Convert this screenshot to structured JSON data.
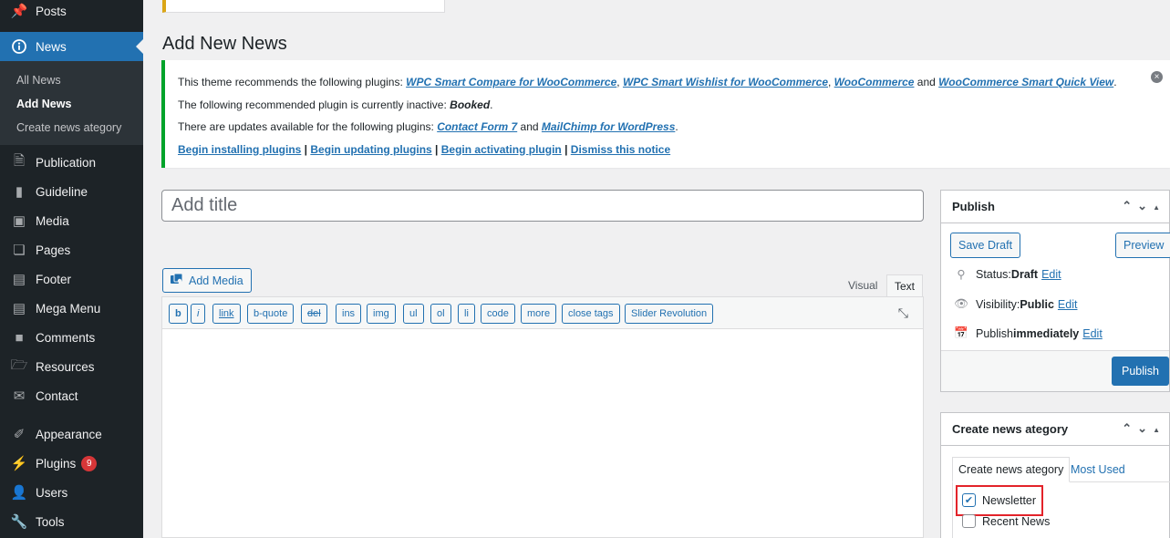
{
  "sidebar": {
    "items": [
      {
        "label": "Posts",
        "icon": "pin-icon"
      },
      {
        "label": "News",
        "icon": "info-icon"
      },
      {
        "label": "Publication",
        "icon": "document-icon"
      },
      {
        "label": "Guideline",
        "icon": "book-icon"
      },
      {
        "label": "Media",
        "icon": "media-icon"
      },
      {
        "label": "Pages",
        "icon": "pages-icon"
      },
      {
        "label": "Footer",
        "icon": "table-icon"
      },
      {
        "label": "Mega Menu",
        "icon": "table-icon"
      },
      {
        "label": "Comments",
        "icon": "comment-icon"
      },
      {
        "label": "Resources",
        "icon": "folder-icon"
      },
      {
        "label": "Contact",
        "icon": "mail-icon"
      },
      {
        "label": "Appearance",
        "icon": "brush-icon"
      },
      {
        "label": "Plugins",
        "icon": "plugin-icon"
      },
      {
        "label": "Users",
        "icon": "users-icon"
      },
      {
        "label": "Tools",
        "icon": "wrench-icon"
      }
    ],
    "submenu": [
      "All News",
      "Add News",
      "Create news ategory"
    ],
    "plugins_badge": "9"
  },
  "page": {
    "title": "Add New News"
  },
  "notice": {
    "line1_prefix": "This theme recommends the following plugins: ",
    "plugin1": "WPC Smart Compare for WooCommerce",
    "sep1": ", ",
    "plugin2": "WPC Smart Wishlist for WooCommerce",
    "sep2": ", ",
    "plugin3": "WooCommerce",
    "and1": " and ",
    "plugin4": "WooCommerce Smart Quick View",
    "end1": ".",
    "line2_prefix": "The following recommended plugin is currently inactive: ",
    "inactive_plugin": "Booked",
    "end2": ".",
    "line3_prefix": "There are updates available for the following plugins: ",
    "update1": "Contact Form 7",
    "and2": " and ",
    "update2": "MailChimp for WordPress",
    "end3": ".",
    "link_install": "Begin installing plugins",
    "link_update": "Begin updating plugins",
    "link_activate": "Begin activating plugin",
    "link_dismiss": "Dismiss this notice",
    "divider": " | "
  },
  "editor": {
    "title_placeholder": "Add title",
    "add_media": "Add Media",
    "tab_visual": "Visual",
    "tab_text": "Text",
    "quicktags": [
      "b",
      "i",
      "link",
      "b-quote",
      "del",
      "ins",
      "img",
      "ul",
      "ol",
      "li",
      "code",
      "more",
      "close tags",
      "Slider Revolution"
    ]
  },
  "publish_box": {
    "title": "Publish",
    "save_draft": "Save Draft",
    "preview": "Preview",
    "status_label": "Status: ",
    "status_value": "Draft",
    "visibility_label": "Visibility: ",
    "visibility_value": "Public",
    "publish_label": "Publish ",
    "publish_value": "immediately",
    "edit": "Edit",
    "publish_button": "Publish"
  },
  "category_box": {
    "title": "Create news ategory",
    "tab_all": "Create news ategory",
    "tab_used": "Most Used",
    "categories": [
      {
        "label": "Newsletter",
        "checked": true
      },
      {
        "label": "Recent News",
        "checked": false
      }
    ]
  },
  "colors": {
    "accent": "#2271b1",
    "sidebar": "#1d2327",
    "notice_border": "#00a32a",
    "highlight": "#e3232a"
  }
}
